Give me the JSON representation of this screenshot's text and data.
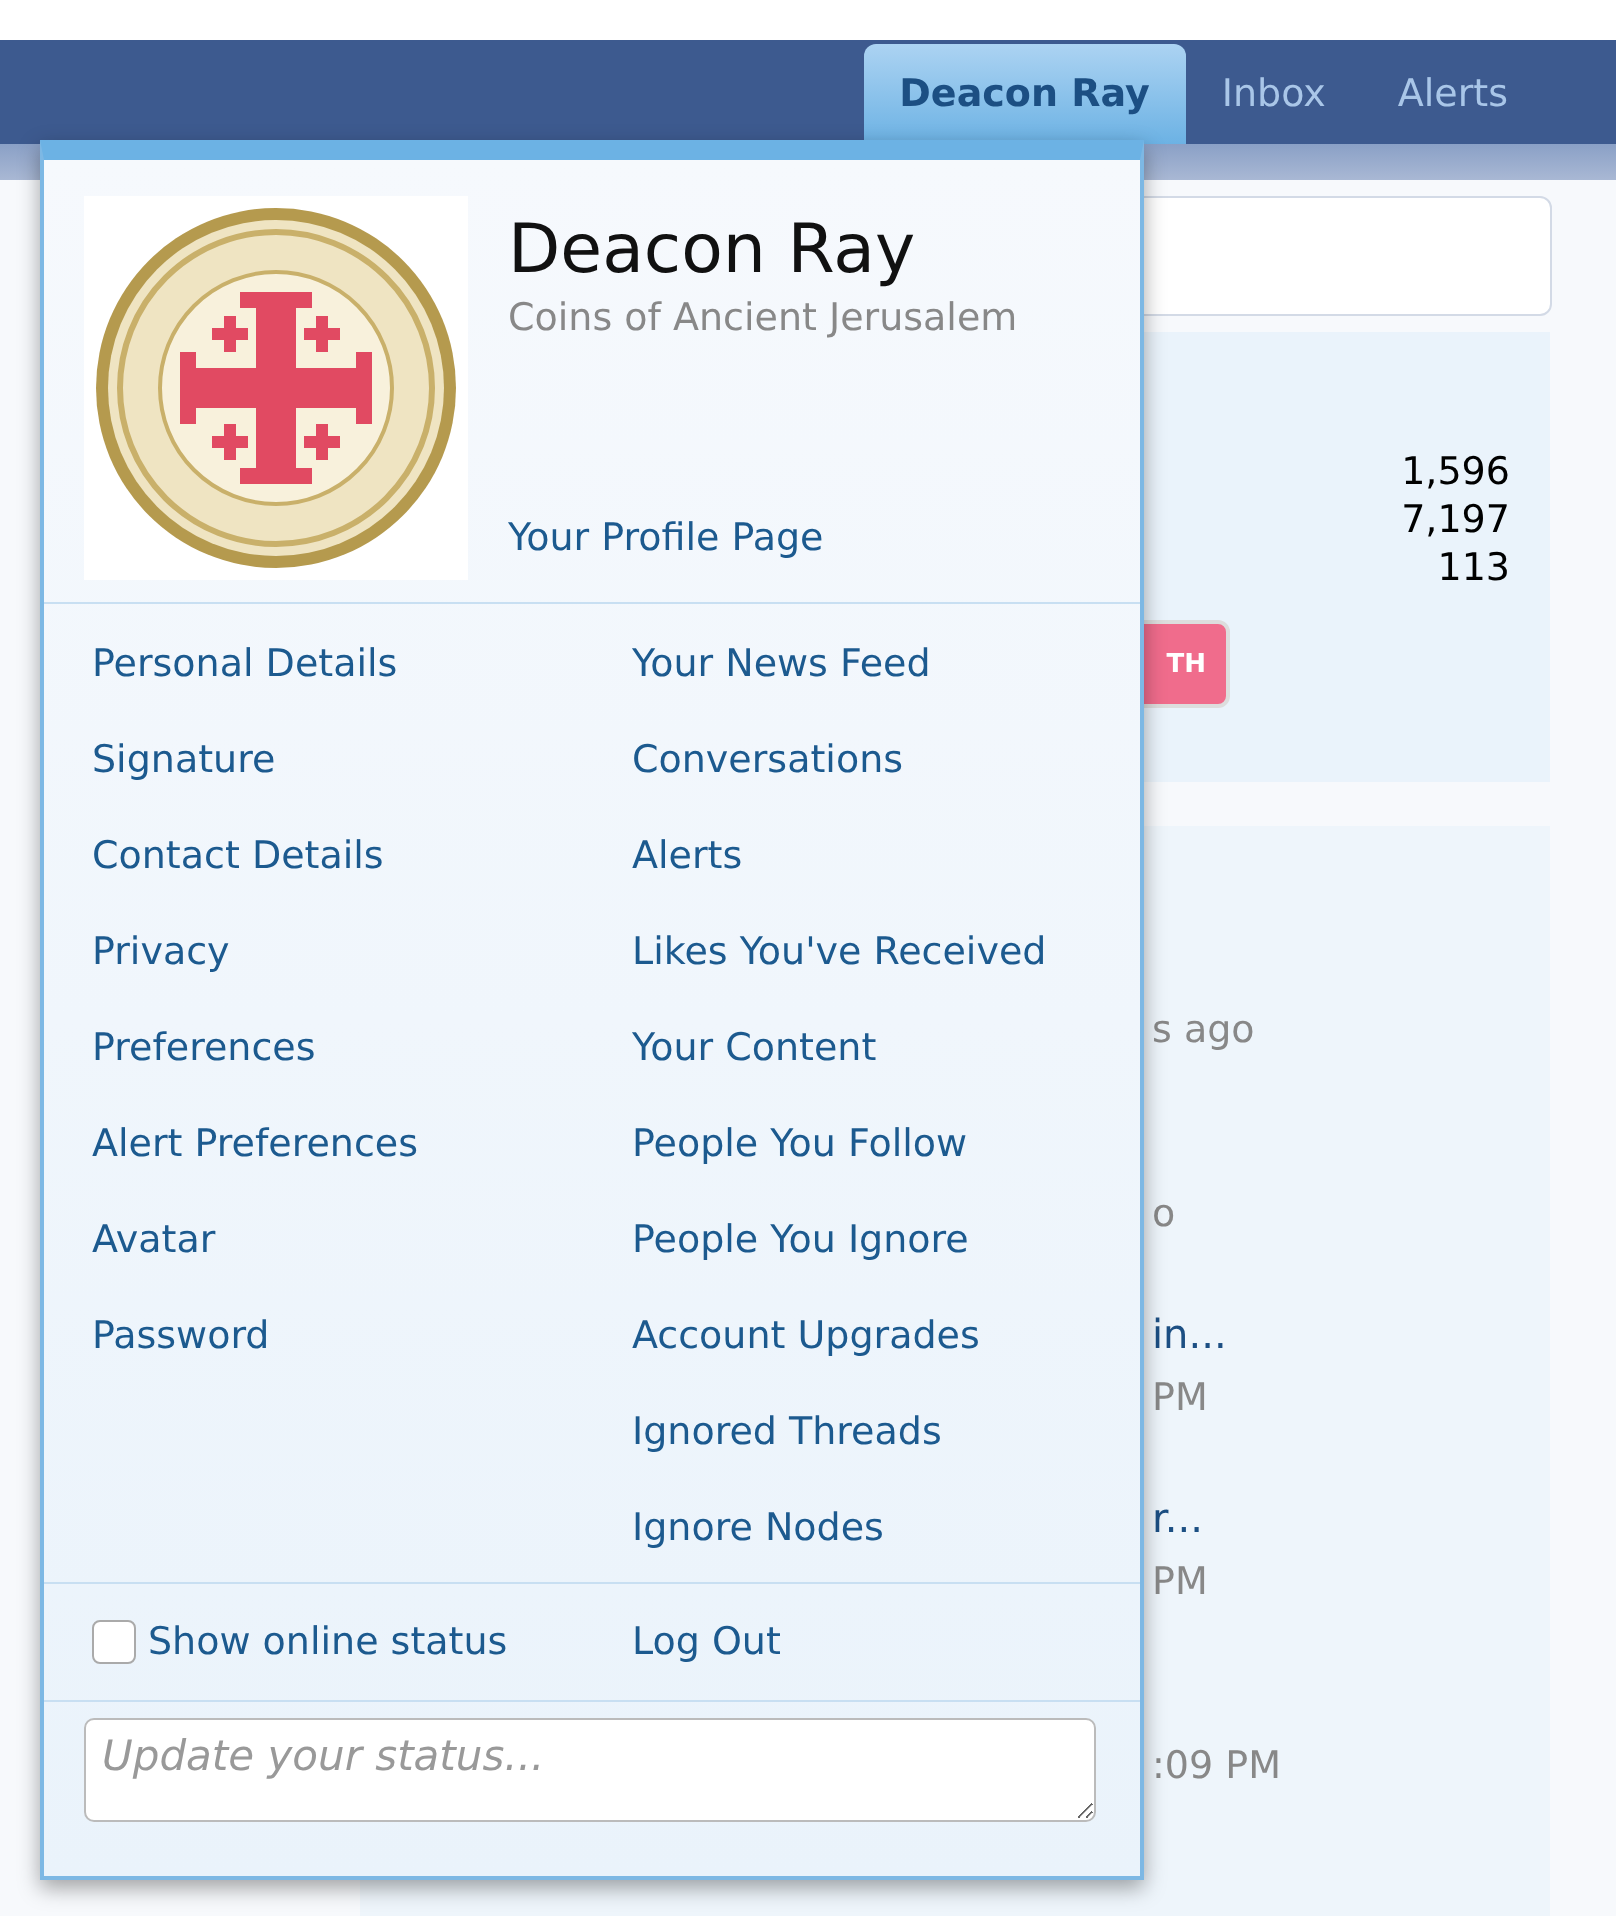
{
  "nav": {
    "tabs": [
      {
        "label": "Deacon Ray",
        "selected": true
      },
      {
        "label": "Inbox",
        "selected": false
      },
      {
        "label": "Alerts",
        "selected": false
      }
    ]
  },
  "background": {
    "stats": [
      "1,596",
      "7,197",
      "113"
    ],
    "button": "TH",
    "topics": [
      {
        "meta": "s ago"
      },
      {
        "meta": "o"
      },
      {
        "title": "in...",
        "meta": "PM"
      },
      {
        "title": "r...",
        "meta": "PM"
      },
      {
        "meta": ":09 PM"
      }
    ]
  },
  "menu": {
    "name": "Deacon Ray",
    "subtitle": "Coins of Ancient Jerusalem",
    "profile_link": "Your Profile Page",
    "left_links": [
      "Personal Details",
      "Signature",
      "Contact Details",
      "Privacy",
      "Preferences",
      "Alert Preferences",
      "Avatar",
      "Password"
    ],
    "right_links": [
      "Your News Feed",
      "Conversations",
      "Alerts",
      "Likes You've Received",
      "Your Content",
      "People You Follow",
      "People You Ignore",
      "Account Upgrades",
      "Ignored Threads",
      "Ignore Nodes"
    ],
    "online_status": {
      "label": "Show online status",
      "checked": false
    },
    "logout": "Log Out",
    "status": {
      "placeholder": "Update your status..."
    }
  }
}
